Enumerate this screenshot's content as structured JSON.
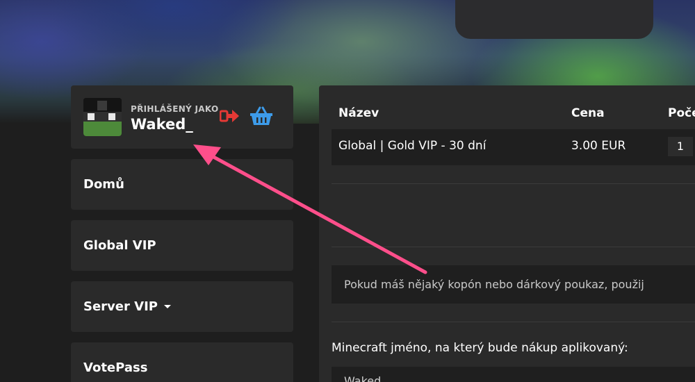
{
  "user": {
    "logged_label": "PŘIHLÁŠENÝ JAKO",
    "name": "Waked_"
  },
  "icons": {
    "logout": "logout-icon",
    "basket": "basket-icon",
    "dropdown": "chevron-down-icon"
  },
  "sidebar": {
    "items": [
      {
        "label": "Domů"
      },
      {
        "label": "Global VIP"
      },
      {
        "label": "Server VIP"
      },
      {
        "label": "VotePass"
      }
    ]
  },
  "cart": {
    "headers": {
      "name": "Název",
      "price": "Cena",
      "quantity": "Poče"
    },
    "rows": [
      {
        "name": "Global | Gold VIP - 30 dní",
        "price": "3.00 EUR",
        "quantity": "1"
      }
    ]
  },
  "coupon": {
    "text": "Pokud máš nějaký kopón nebo dárkový poukaz, použij"
  },
  "minecraft": {
    "label": "Minecraft jméno, na který bude nákup aplikovaný:",
    "value": "Waked_"
  },
  "colors": {
    "background": "#1e1e1e",
    "card": "#2a2a2a",
    "logout_red": "#e53935",
    "basket_blue": "#3d9be9",
    "annotation_pink": "#ff4f8b"
  }
}
